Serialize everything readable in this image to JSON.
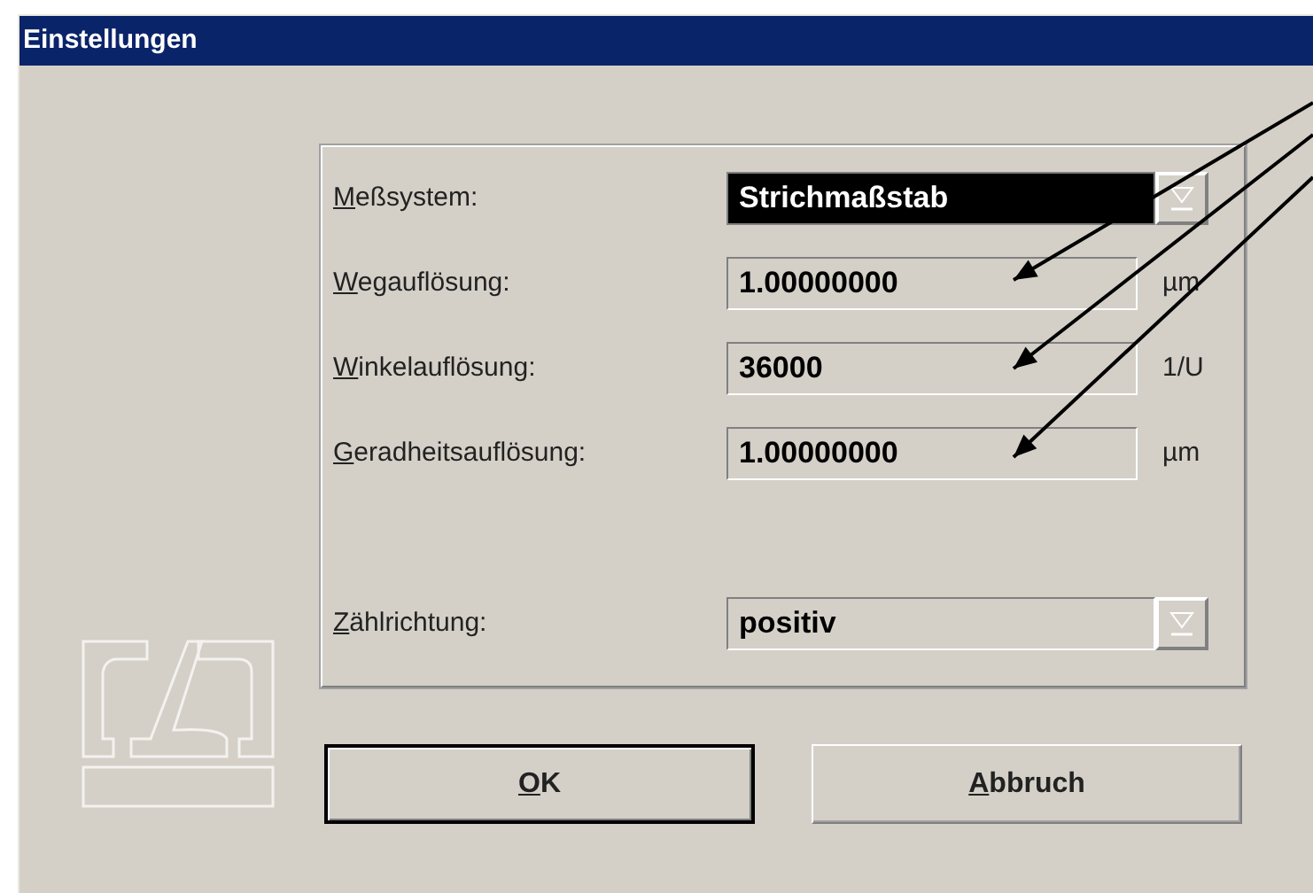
{
  "window": {
    "title": "Einstellungen"
  },
  "fields": [
    {
      "kind": "dropdown",
      "label": "Meßsystem:",
      "value": "Strichmaßstab",
      "focused": true
    },
    {
      "kind": "text",
      "label": "Wegauflösung:",
      "value": "1.00000000",
      "unit": "µm"
    },
    {
      "kind": "text",
      "label": "Winkelauflösung:",
      "value": "36000",
      "unit": "1/U"
    },
    {
      "kind": "text",
      "label": "Geradheitsauflösung:",
      "value": "1.00000000",
      "unit": "µm"
    }
  ],
  "count_field": {
    "kind": "dropdown",
    "label": "Zählrichtung:",
    "value": "positiv",
    "focused": false
  },
  "buttons": [
    {
      "label": "OK",
      "default": true
    },
    {
      "label": "Abbruch",
      "default": false
    }
  ]
}
